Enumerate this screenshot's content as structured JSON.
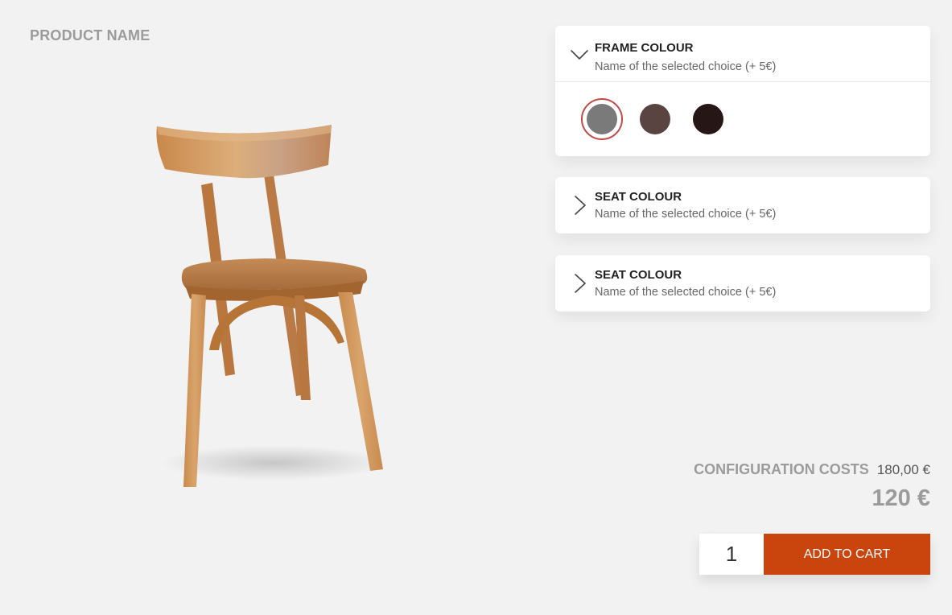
{
  "product": {
    "name": "PRODUCT NAME"
  },
  "options": [
    {
      "title": "FRAME COLOUR",
      "subtitle": "Name of the selected choice (+ 5€)",
      "expanded": true,
      "icon": "chevron-down-icon",
      "swatches": [
        {
          "color": "#7a7a7a",
          "selected": true
        },
        {
          "color": "#5a4442",
          "selected": false
        },
        {
          "color": "#261616",
          "selected": false
        }
      ]
    },
    {
      "title": "SEAT COLOUR",
      "subtitle": "Name of the selected choice (+ 5€)",
      "expanded": false,
      "icon": "chevron-right-icon"
    },
    {
      "title": "SEAT COLOUR",
      "subtitle": "Name of the selected choice (+ 5€)",
      "expanded": false,
      "icon": "chevron-right-icon"
    }
  ],
  "pricing": {
    "config_label": "CONFIGURATION COSTS",
    "config_value": "180,00 €",
    "total": "120 €"
  },
  "cart": {
    "quantity": "1",
    "button_label": "ADD TO CART"
  },
  "colors": {
    "accent": "#c9450d",
    "selected_ring": "#c04a45",
    "muted_text": "#9b9b9b",
    "background": "#f2f2f2"
  }
}
